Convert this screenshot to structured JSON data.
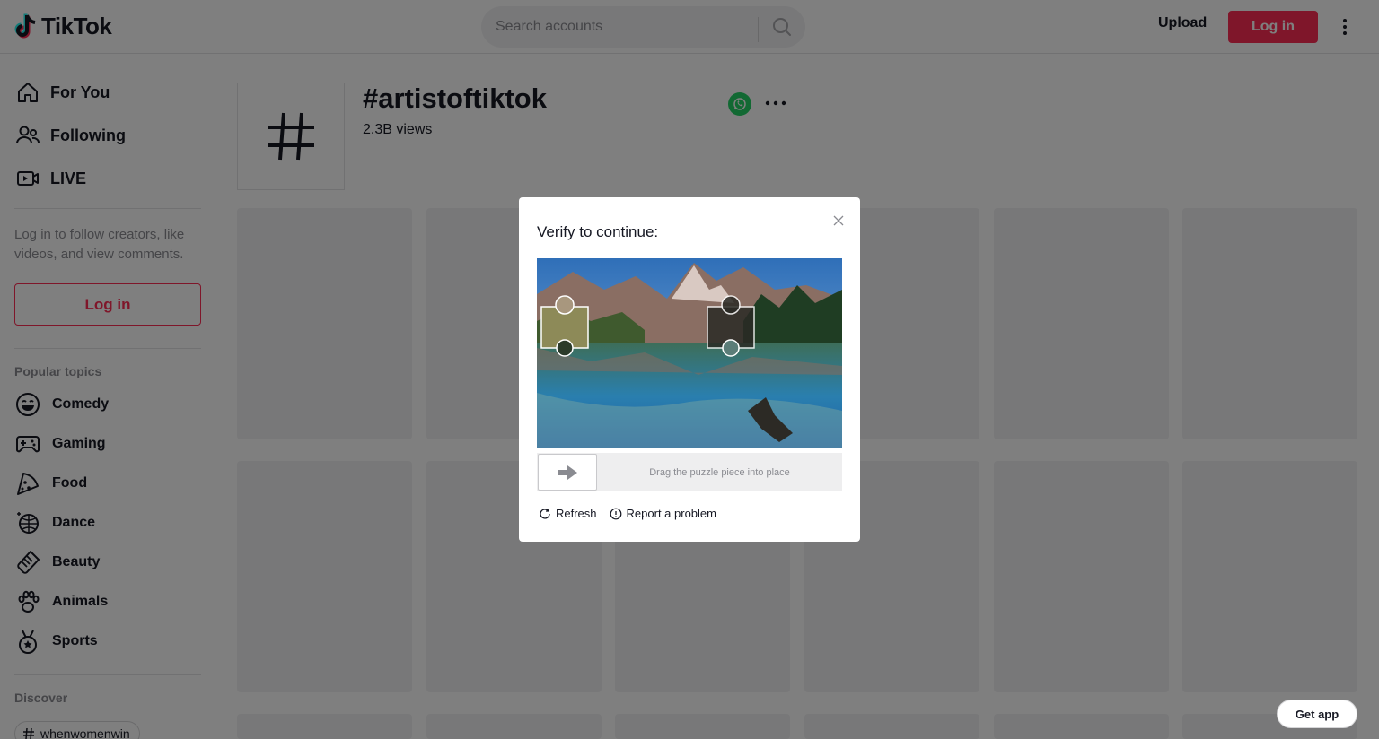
{
  "header": {
    "logo_text": "TikTok",
    "search_placeholder": "Search accounts",
    "upload_label": "Upload",
    "login_label": "Log in"
  },
  "sidebar": {
    "nav": [
      {
        "label": "For You",
        "icon": "home-icon"
      },
      {
        "label": "Following",
        "icon": "people-icon"
      },
      {
        "label": "LIVE",
        "icon": "live-icon"
      }
    ],
    "login_tip": "Log in to follow creators, like videos, and view comments.",
    "login_label": "Log in",
    "popular_title": "Popular topics",
    "topics": [
      {
        "label": "Comedy",
        "icon": "smile-icon"
      },
      {
        "label": "Gaming",
        "icon": "gamepad-icon"
      },
      {
        "label": "Food",
        "icon": "pizza-icon"
      },
      {
        "label": "Dance",
        "icon": "disco-ball-icon"
      },
      {
        "label": "Beauty",
        "icon": "comb-icon"
      },
      {
        "label": "Animals",
        "icon": "paw-icon"
      },
      {
        "label": "Sports",
        "icon": "medal-icon"
      }
    ],
    "discover_title": "Discover",
    "discover_tags": [
      "whenwomenwin"
    ]
  },
  "main": {
    "tag_title": "#artistoftiktok",
    "tag_views": "2.3B views"
  },
  "captcha": {
    "title": "Verify to continue:",
    "slider_hint": "Drag the puzzle piece into place",
    "refresh_label": "Refresh",
    "report_label": "Report a problem"
  },
  "get_app_label": "Get app",
  "colors": {
    "brand_red": "#fe2c55",
    "whatsapp_green": "#25d366",
    "overlay": "rgba(0,0,0,0.5)"
  }
}
